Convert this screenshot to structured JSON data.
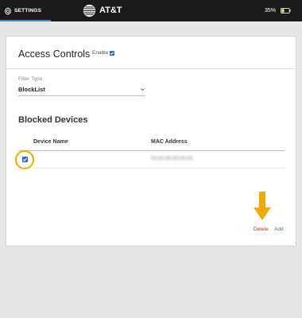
{
  "topbar": {
    "tab_label": "SETTINGS",
    "brand": "AT&T",
    "battery_text": "35%",
    "battery_level": 0.35,
    "accent_color": "#3a8ed9"
  },
  "access_controls": {
    "title": "Access Controls",
    "enable_label": "Enable",
    "enable_checked": true
  },
  "filter": {
    "label": "Filter Type",
    "value": "BlockList"
  },
  "blocked_devices": {
    "title": "Blocked Devices",
    "columns": [
      "Device Name",
      "MAC Address"
    ],
    "rows": [
      {
        "checked": true,
        "device_name": "-",
        "mac_address": "00:00:00:00:00:00"
      }
    ]
  },
  "actions": {
    "delete_label": "Delete",
    "add_label": "Add",
    "delete_color": "#d0312d",
    "add_color": "#2f6fd1"
  },
  "annotation_color": "#f2a900"
}
